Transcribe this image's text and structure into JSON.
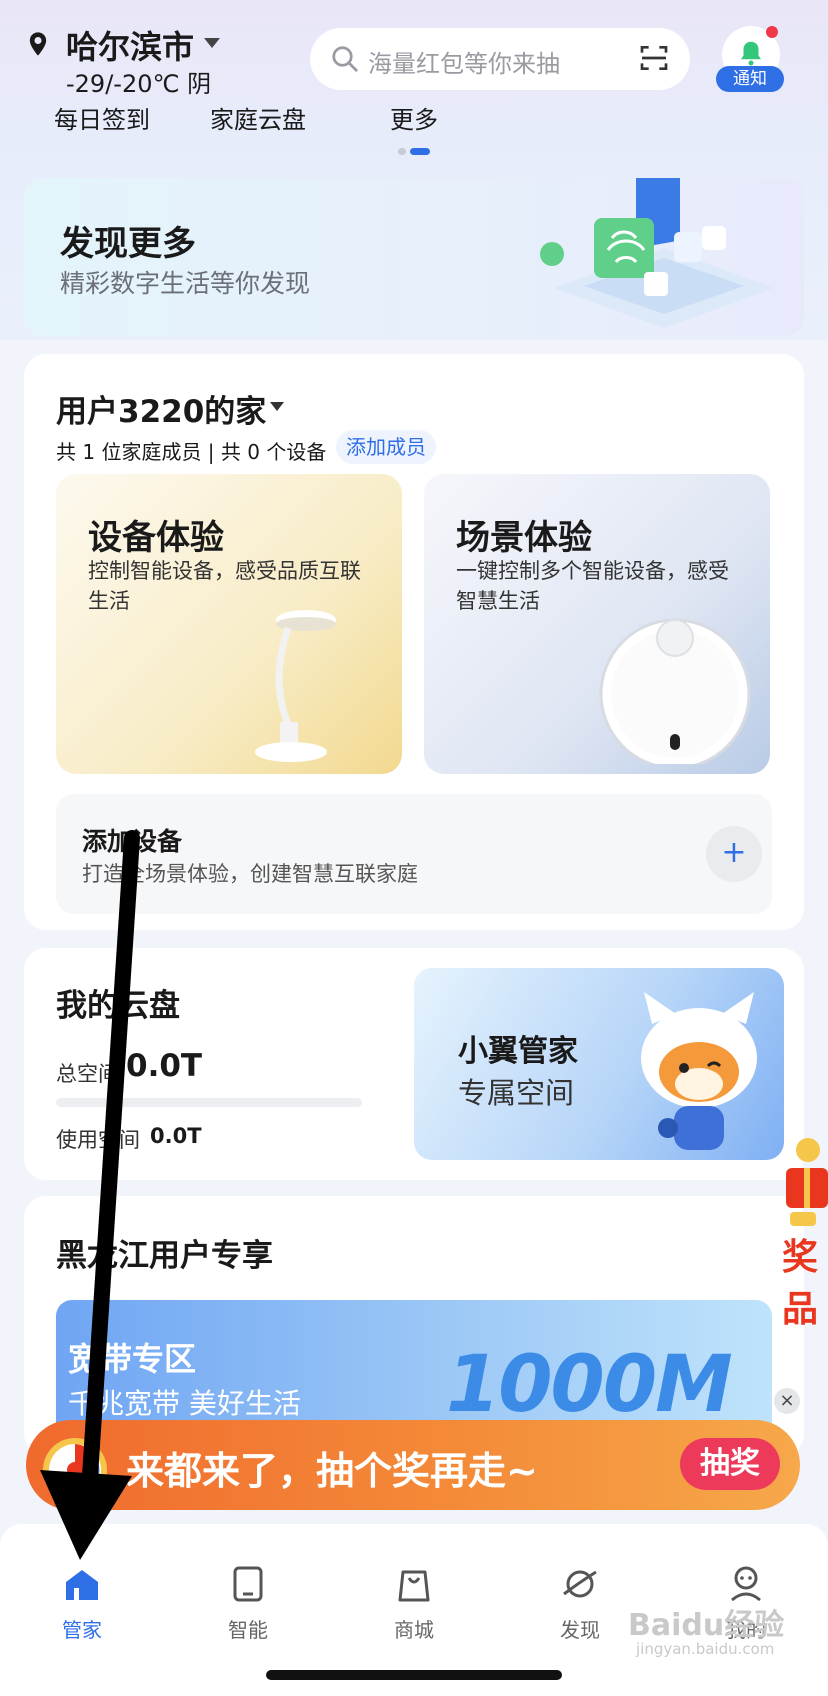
{
  "header": {
    "city": "哈尔滨市",
    "weather": "-29/-20℃  阴",
    "search_placeholder": "海量红包等你来抽",
    "notify_label": "通知"
  },
  "quick_nav": [
    "每日签到",
    "家庭云盘",
    "更多"
  ],
  "discover": {
    "title": "发现更多",
    "subtitle": "精彩数字生活等你发现"
  },
  "home": {
    "title": "用户3220的家",
    "summary": "共 1 位家庭成员 | 共 0 个设备",
    "add_member": "添加成员",
    "device_exp": {
      "title": "设备体验",
      "desc": "控制智能设备，感受品质互联生活"
    },
    "scene_exp": {
      "title": "场景体验",
      "desc": "一键控制多个智能设备，感受智慧生活"
    },
    "add_device": {
      "title": "添加设备",
      "subtitle": "打造全场景体验，创建智慧互联家庭",
      "button": "+"
    }
  },
  "cloud": {
    "title": "我的云盘",
    "total_label": "总空间",
    "total_value": "0.0T",
    "used_label": "使用空间",
    "used_value": "0.0T",
    "banner_title": "小翼管家",
    "banner_subtitle": "专属空间"
  },
  "region": {
    "title": "黑龙江用户专享",
    "banner_title": "宽带专区",
    "banner_subtitle": "千兆宽带  美好生活",
    "banner_big": "1000M"
  },
  "side_prize": "奖品",
  "lottery": {
    "text": "来都来了，抽个奖再走~",
    "button": "抽奖",
    "close": "×"
  },
  "tabs": [
    {
      "label": "管家",
      "icon": "home-icon",
      "active": true
    },
    {
      "label": "智能",
      "icon": "tablet-icon",
      "active": false
    },
    {
      "label": "商城",
      "icon": "shopping-bag-icon",
      "active": false
    },
    {
      "label": "发现",
      "icon": "planet-icon",
      "active": false
    },
    {
      "label": "我的",
      "icon": "profile-icon",
      "active": false
    }
  ],
  "watermark": {
    "main": "Baidu经验",
    "sub": "jingyan.baidu.com"
  },
  "colors": {
    "accent": "#2f6fe6",
    "lottery": "#f48a38",
    "lottery_button": "#ee3a5a"
  }
}
